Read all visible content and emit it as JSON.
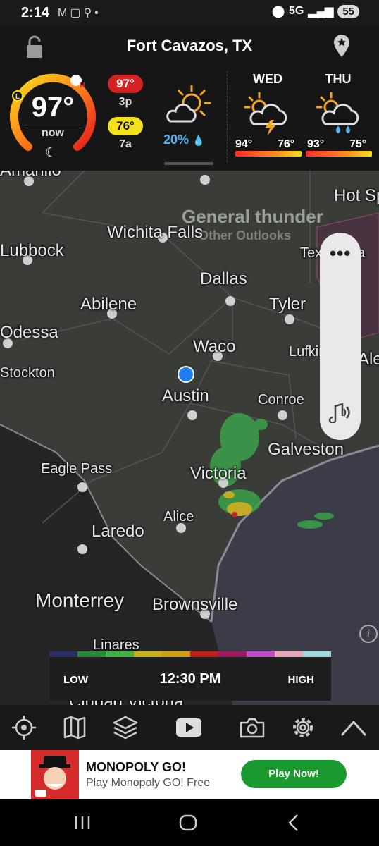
{
  "status_bar": {
    "time": "2:14",
    "left_icons": [
      "mail-icon",
      "copy-icon",
      "search-icon"
    ],
    "network": "5G",
    "battery": "55"
  },
  "header": {
    "location": "Fort Cavazos, TX",
    "current": {
      "temp": "97°",
      "label": "now",
      "gauge_markers": [
        "L",
        "H"
      ]
    },
    "today_high": {
      "temp": "97°",
      "time": "3p"
    },
    "today_low": {
      "temp": "76°",
      "time": "7a"
    },
    "precip_chance": "20%",
    "forecast": [
      {
        "day": "WED",
        "icon": "thunderstorm-icon",
        "high": "94°",
        "low": "76°"
      },
      {
        "day": "THU",
        "icon": "rain-icon",
        "high": "93°",
        "low": "75°"
      }
    ]
  },
  "map": {
    "overlay": {
      "title": "General thunder",
      "subtitle": "Other Outlooks"
    },
    "cities": {
      "amarillo": "Amarillo",
      "hot_springs": "Hot Sp",
      "wichita_falls": "Wichita Falls",
      "lubbock": "Lubbock",
      "texarkana": "Texarkana",
      "dallas": "Dallas",
      "abilene": "Abilene",
      "tyler": "Tyler",
      "odessa": "Odessa",
      "waco": "Waco",
      "lufkin": "Lufkin",
      "ale": "Ale",
      "stockton": "Stockton",
      "austin": "Austin",
      "conroe": "Conroe",
      "galveston": "Galveston",
      "eagle_pass": "Eagle Pass",
      "victoria": "Victoria",
      "alice": "Alice",
      "laredo": "Laredo",
      "monterrey": "Monterrey",
      "brownsville": "Brownsville",
      "linares": "Linares",
      "ciudad_victoria": "Ciudad Victoria"
    },
    "legend": {
      "low": "LOW",
      "high": "HIGH",
      "time": "12:30 PM",
      "colors": [
        "#2a2f6a",
        "#2a8a3a",
        "#40b040",
        "#c8b020",
        "#d0a010",
        "#c02020",
        "#a01a60",
        "#c04ac8",
        "#e8a8b8",
        "#9fd8e0"
      ]
    }
  },
  "toolbar": [
    "locate-icon",
    "map-icon",
    "layers-icon",
    "play-icon",
    "camera-icon",
    "settings-icon",
    "expand-up-icon"
  ],
  "ad": {
    "title": "MONOPOLY GO!",
    "subtitle": "Play Monopoly GO! Free",
    "cta": "Play Now!"
  },
  "nav": [
    "recents-icon",
    "home-icon",
    "back-icon"
  ]
}
